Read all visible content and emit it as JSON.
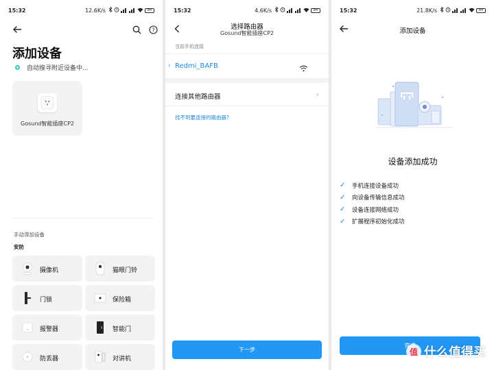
{
  "screen1": {
    "status": {
      "time": "15:32",
      "speed": "12.6K/s",
      "battery": "84"
    },
    "title": "添加设备",
    "scanning_text": "自动搜寻附近设备中...",
    "found_device": "Gosund智能插座CP2",
    "manual_add_label": "手动添加设备",
    "category_label": "安防",
    "tiles": [
      {
        "label": "摄像机",
        "icon": "camera-icon"
      },
      {
        "label": "猫眼门铃",
        "icon": "doorbell-icon"
      },
      {
        "label": "门锁",
        "icon": "door-lock-icon"
      },
      {
        "label": "保险箱",
        "icon": "safe-box-icon"
      },
      {
        "label": "报警器",
        "icon": "alarm-icon"
      },
      {
        "label": "智能门",
        "icon": "smart-door-icon"
      },
      {
        "label": "防丢器",
        "icon": "anti-lost-icon"
      },
      {
        "label": "对讲机",
        "icon": "intercom-icon"
      }
    ]
  },
  "screen2": {
    "status": {
      "time": "15:32",
      "speed": "4.6K/s",
      "battery": "84"
    },
    "title": "选择路由器",
    "subtitle": "Gosund智能插座CP2",
    "section_label": "当前手机连接",
    "current_wifi": "Redmi_BAFB",
    "other_router": "连接其他路由器",
    "help_link": "找不到要连接的路由器?",
    "next_button": "下一步"
  },
  "screen3": {
    "status": {
      "time": "15:32",
      "speed": "21.8K/s",
      "battery": "84"
    },
    "title": "添加设备",
    "success_title": "设备添加成功",
    "steps": [
      "手机连接设备成功",
      "向设备传输信息成功",
      "设备连接网络成功",
      "扩展程序初始化成功"
    ],
    "finish_button": "完成"
  },
  "watermark": {
    "badge": "值",
    "text": "什么值得买"
  },
  "colors": {
    "accent": "#2196f3",
    "teal": "#32c7b8",
    "check": "#1e88e5"
  }
}
